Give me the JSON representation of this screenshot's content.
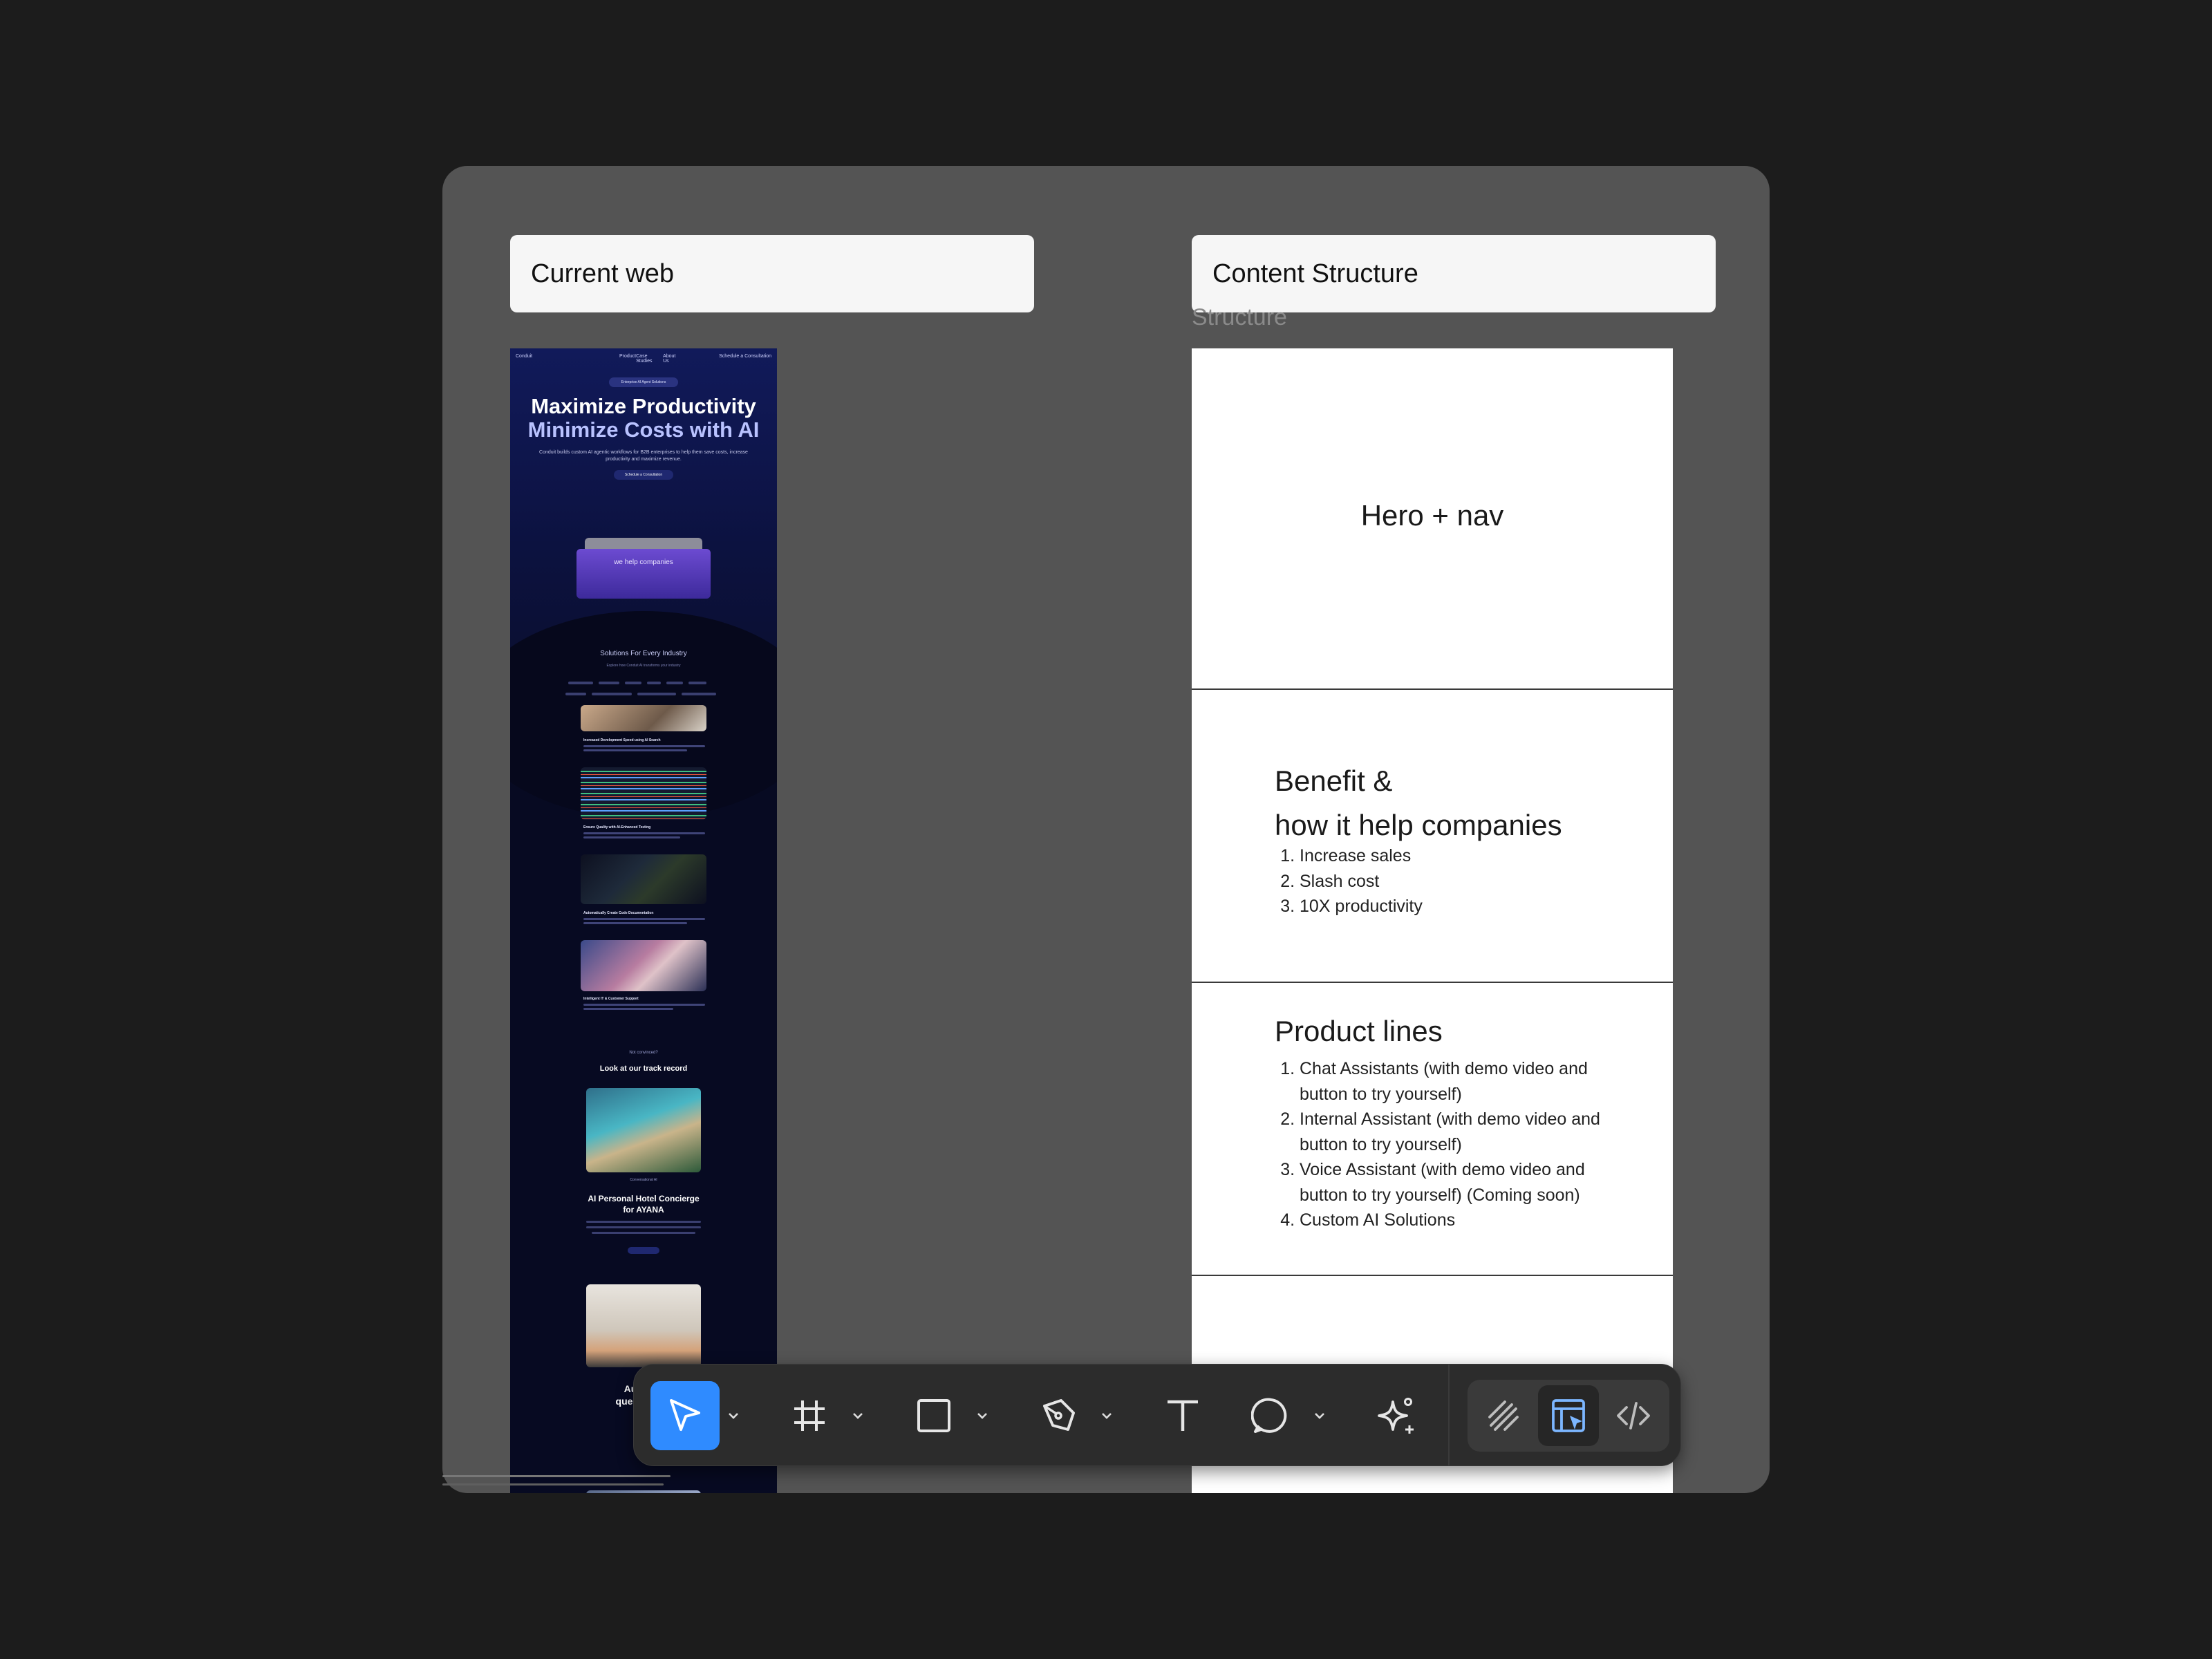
{
  "labels": {
    "current_web": "Current web",
    "content_structure": "Content Structure",
    "ghost_text": "Structure"
  },
  "site": {
    "nav_brand": "Conduit",
    "nav_links": [
      "Product",
      "Case Studies",
      "About Us"
    ],
    "nav_cta": "Schedule a Consultation",
    "pill": "Enterprise AI Agent Solutions",
    "headline_1": "Maximize Productivity",
    "headline_2": "Minimize Costs with AI",
    "subtext": "Conduit builds custom AI agentic workflows for B2B enterprises to help them save costs, increase productivity and maximize revenue.",
    "button": "Schedule a Consultation",
    "card_text": "we help companies",
    "solutions_title": "Solutions For Every Industry",
    "solutions_sub": "Explore how Conduit AI transforms your industry",
    "case_captions": [
      "Increased Development Speed using AI Search",
      "Ensure Quality with AI-Enhanced Testing",
      "Automatically Create Code Documentation",
      "Intelligent IT & Customer Support"
    ],
    "track_small": "Not convinced?",
    "track_title": "Look at our track record",
    "case_small": "Conversational AI",
    "ai_title_1": "AI Personal Hotel Concierge",
    "ai_title_2": "for AYANA",
    "auto_title_1": "Automat",
    "auto_title_2": "queries for t"
  },
  "structure": {
    "hero": "Hero + nav",
    "benefit_title_1": "Benefit &",
    "benefit_title_2": "how it help companies",
    "benefit_items": [
      "Increase sales",
      "Slash cost",
      "10X productivity"
    ],
    "products_title": "Product lines",
    "product_items": [
      "Chat Assistants (with demo video and button to try yourself)",
      "Internal Assistant (with demo video and button to try yourself)",
      "Voice Assistant (with demo video and button to try yourself) (Coming soon)",
      "Custom AI Solutions"
    ]
  },
  "toolbar": {
    "tools": [
      "move-tool",
      "frame-tool",
      "rectangle-tool",
      "pen-tool",
      "text-tool",
      "comment-tool",
      "ai-actions-tool"
    ],
    "modes": [
      "draw-mode",
      "design-mode",
      "dev-mode"
    ],
    "accent": "#2f8bff"
  }
}
